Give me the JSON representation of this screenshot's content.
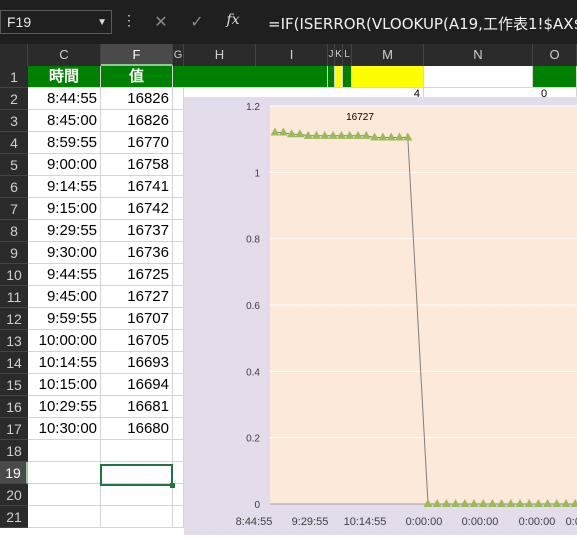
{
  "formula_bar": {
    "name_box": "F19",
    "cancel_icon": "✕",
    "enter_icon": "✓",
    "fx_icon": "fx",
    "formula": "=IF(ISERROR(VLOOKUP(A19,工作表1!$AX$1"
  },
  "columns": [
    "C",
    "F",
    "G",
    "H",
    "I",
    "J",
    "K",
    "L",
    "M",
    "N",
    "O"
  ],
  "rows": [
    "1",
    "2",
    "3",
    "4",
    "5",
    "6",
    "7",
    "8",
    "9",
    "10",
    "11",
    "12",
    "13",
    "14",
    "15",
    "16",
    "17",
    "18",
    "19",
    "20",
    "21"
  ],
  "table": {
    "header_time": "時間",
    "header_value": "值",
    "times": [
      "8:44:55",
      "8:45:00",
      "8:59:55",
      "9:00:00",
      "9:14:55",
      "9:15:00",
      "9:29:55",
      "9:30:00",
      "9:44:55",
      "9:45:00",
      "9:59:55",
      "10:00:00",
      "10:14:55",
      "10:15:00",
      "10:29:55",
      "10:30:00"
    ],
    "values": [
      "16826",
      "16826",
      "16770",
      "16758",
      "16741",
      "16742",
      "16737",
      "16736",
      "16725",
      "16727",
      "16707",
      "16705",
      "16693",
      "16694",
      "16681",
      "16680"
    ]
  },
  "partial_cells": {
    "m2": "4",
    "o2": "0"
  },
  "chart_data": {
    "type": "line",
    "annotation": "16727",
    "y_ticks": [
      "0",
      "0.2",
      "0.4",
      "0.6",
      "0.8",
      "1",
      "1.2"
    ],
    "x_tick_labels": [
      "8:44:55",
      "9:29:55",
      "10:14:55",
      "0:00:00",
      "0:00:00",
      "0:00:00",
      "0:00:00"
    ],
    "ylim": [
      0,
      1.2
    ],
    "series": [
      {
        "values": [
          1.12,
          1.12,
          1.115,
          1.115,
          1.11,
          1.11,
          1.11,
          1.11,
          1.11,
          1.11,
          1.11,
          1.11,
          1.105,
          1.105,
          1.105,
          1.105,
          1.105,
          0,
          0,
          0,
          0,
          0,
          0,
          0,
          0,
          0,
          0,
          0,
          0,
          0,
          0,
          0,
          0,
          0,
          0,
          0,
          0,
          0,
          0,
          0,
          0,
          0,
          0
        ]
      }
    ],
    "colors": {
      "marker": "#9bbb59",
      "line": "#7f7f7f",
      "plot_bg": "#fde9d9",
      "chart_bg": "#e4dcea",
      "grid": "#ffffff"
    }
  }
}
